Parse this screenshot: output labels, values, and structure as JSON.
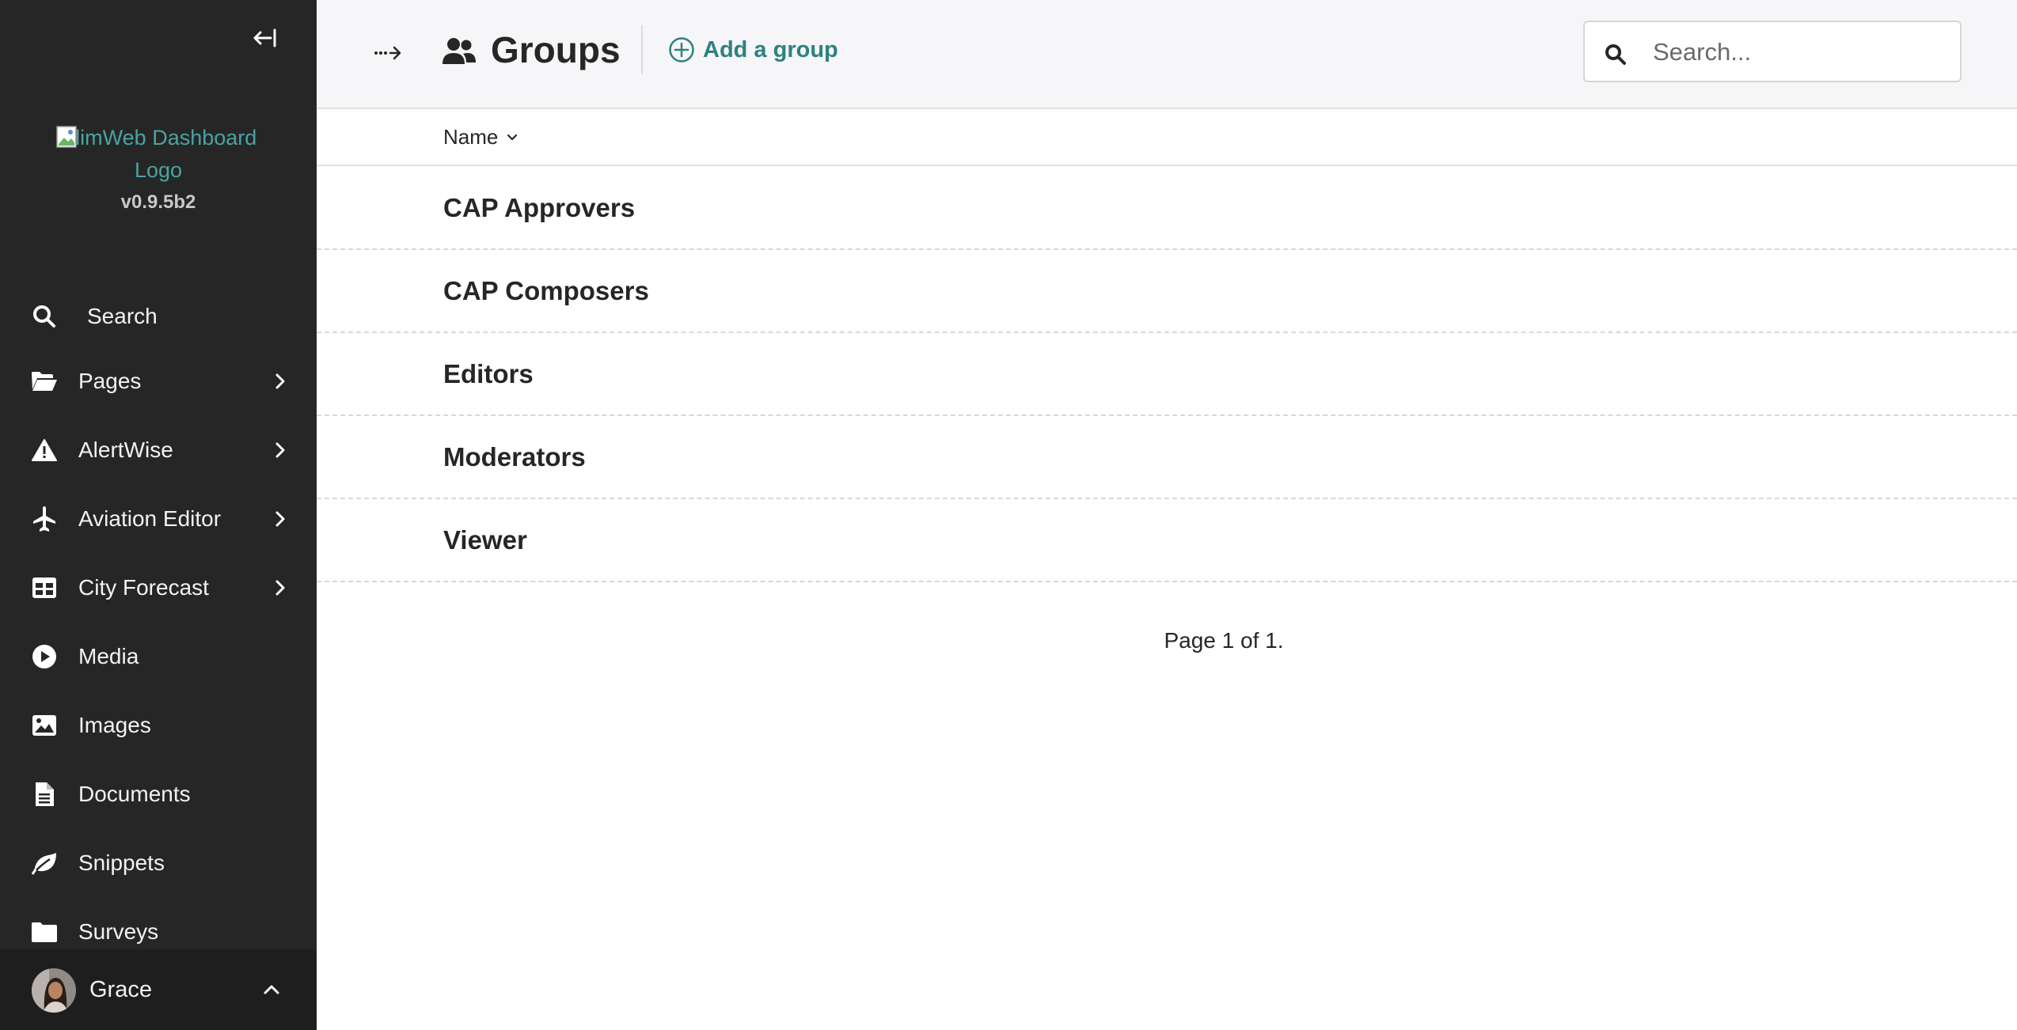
{
  "sidebar": {
    "collapse_icon": "collapse-sidebar-icon",
    "logo_alt": "ClimWeb Dashboard Logo",
    "version": "v0.9.5b2",
    "items": [
      {
        "label": "Search",
        "icon": "search-icon",
        "has_submenu": false
      },
      {
        "label": "Pages",
        "icon": "folder-open-icon",
        "has_submenu": true
      },
      {
        "label": "AlertWise",
        "icon": "warning-icon",
        "has_submenu": true
      },
      {
        "label": "Aviation Editor",
        "icon": "plane-icon",
        "has_submenu": true
      },
      {
        "label": "City Forecast",
        "icon": "table-icon",
        "has_submenu": true
      },
      {
        "label": "Media",
        "icon": "play-icon",
        "has_submenu": false
      },
      {
        "label": "Images",
        "icon": "image-icon",
        "has_submenu": false
      },
      {
        "label": "Documents",
        "icon": "document-icon",
        "has_submenu": false
      },
      {
        "label": "Snippets",
        "icon": "snippet-icon",
        "has_submenu": false
      },
      {
        "label": "Surveys",
        "icon": "folder-icon",
        "has_submenu": false
      }
    ],
    "account": {
      "name": "Grace",
      "icon": "chevron-up-icon"
    }
  },
  "header": {
    "title": "Groups",
    "title_icon": "group-icon",
    "add_label": "Add a group",
    "search_placeholder": "Search..."
  },
  "listing": {
    "column_header": "Name",
    "rows": [
      "CAP Approvers",
      "CAP Composers",
      "Editors",
      "Moderators",
      "Viewer"
    ],
    "pagination": "Page 1 of 1."
  },
  "colors": {
    "sidebar_bg": "#262626",
    "accent": "#2e8181",
    "header_bg": "#f6f6f8"
  }
}
